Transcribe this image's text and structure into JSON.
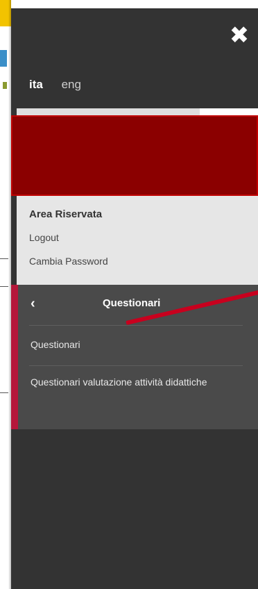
{
  "drawer": {
    "close_icon": "close-icon",
    "languages": [
      {
        "label": "ita",
        "active": true
      },
      {
        "label": "eng",
        "active": false
      }
    ]
  },
  "reserved_area": {
    "title": "Area Riservata",
    "links": [
      "Logout",
      "Cambia Password"
    ]
  },
  "submenu": {
    "back_icon": "chevron-left-icon",
    "title": "Questionari",
    "items": [
      "Questionari",
      "Questionari valutazione attività didattiche"
    ]
  },
  "colors": {
    "drawer_bg": "#333333",
    "submenu_bg": "#4a4a4a",
    "accent": "#b5173a",
    "redacted": "#8b0000",
    "arrow": "#c8001e"
  }
}
